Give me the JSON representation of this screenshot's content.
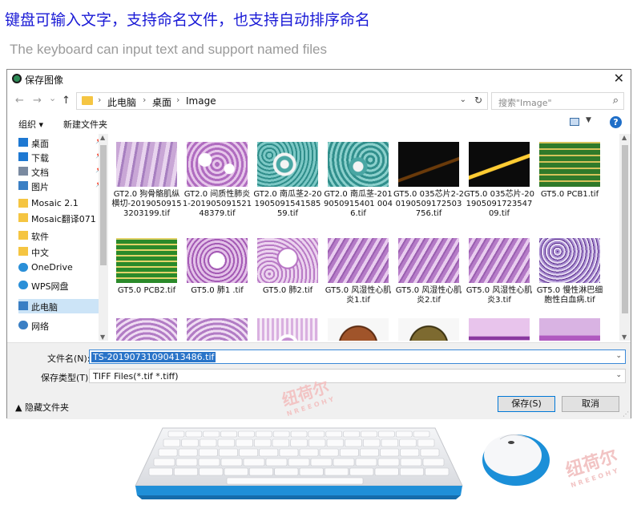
{
  "promo": {
    "cn": "键盘可输入文字，支持命名文件，也支持自动排序命名",
    "en": "The keyboard can input text and support named files"
  },
  "dialog": {
    "title": "保存图像",
    "close_glyph": "✕",
    "nav": {
      "back": "←",
      "forward": "→",
      "recent": "⌄",
      "up": "↑"
    },
    "breadcrumb": [
      "此电脑",
      "桌面",
      "Image"
    ],
    "search_placeholder": "搜索\"Image\"",
    "toolbar": {
      "organize": "组织 ▾",
      "new_folder": "新建文件夹",
      "help": "?"
    },
    "nav_pane": [
      {
        "label": "桌面",
        "icon": "desktop-icon",
        "pinned": true
      },
      {
        "label": "下载",
        "icon": "download-icon",
        "pinned": true
      },
      {
        "label": "文档",
        "icon": "document-icon",
        "pinned": true
      },
      {
        "label": "图片",
        "icon": "picture-icon",
        "pinned": true
      },
      {
        "label": "Mosaic 2.1",
        "icon": "folder-icon",
        "pinned": false
      },
      {
        "label": "Mosaic翻译071",
        "icon": "folder-icon",
        "pinned": false
      },
      {
        "label": "软件",
        "icon": "folder-icon",
        "pinned": false
      },
      {
        "label": "中文",
        "icon": "folder-icon",
        "pinned": false
      },
      {
        "label": "OneDrive",
        "icon": "cloud-icon",
        "pinned": false
      },
      {
        "label": "WPS网盘",
        "icon": "cloud-icon",
        "pinned": false
      },
      {
        "label": "此电脑",
        "icon": "computer-icon",
        "pinned": false,
        "selected": true
      },
      {
        "label": "网络",
        "icon": "network-icon",
        "pinned": false
      }
    ],
    "files": [
      {
        "caption": "GT2.0 狗骨骼肌纵横切-20190509153203199.tif",
        "thumb": "muscle"
      },
      {
        "caption": "GT2.0 间质性肺炎1-20190509152148379.tif",
        "thumb": "lung"
      },
      {
        "caption": "GT2.0 南瓜茎2-20190509154158559.tif",
        "thumb": "stem"
      },
      {
        "caption": "GT2.0 南瓜茎-2019050915401 0046.tif",
        "thumb": "stem2"
      },
      {
        "caption": "GT5.0 035芯片2-20190509172503756.tif",
        "thumb": "chip"
      },
      {
        "caption": "GT5.0 035芯片-20190509172354709.tif",
        "thumb": "chip2"
      },
      {
        "caption": "GT5.0 PCB1.tif",
        "thumb": "pcb"
      },
      {
        "caption": "GT5.0 PCB2.tif",
        "thumb": "pcb2"
      },
      {
        "caption": "GT5.0 肺1 .tif",
        "thumb": "lung2"
      },
      {
        "caption": "GT5.0 肺2.tif",
        "thumb": "lung3"
      },
      {
        "caption": "GT5.0 风湿性心肌炎1.tif",
        "thumb": "heart"
      },
      {
        "caption": "GT5.0 风湿性心肌炎2.tif",
        "thumb": "heart"
      },
      {
        "caption": "GT5.0 风湿性心肌炎3.tif",
        "thumb": "heart"
      },
      {
        "caption": "GT5.0 慢性淋巴细胞性白血病.tif",
        "thumb": "blood"
      },
      {
        "caption": "",
        "thumb": "intestine"
      },
      {
        "caption": "",
        "thumb": "intestine"
      },
      {
        "caption": "",
        "thumb": "intestine2"
      },
      {
        "caption": "",
        "thumb": "coin"
      },
      {
        "caption": "",
        "thumb": "coin2"
      },
      {
        "caption": "",
        "thumb": "tissue"
      },
      {
        "caption": "",
        "thumb": "tissue2"
      }
    ],
    "file_name_label": "文件名(N):",
    "file_name_value": "TS-20190731090413486.tif",
    "file_type_label": "保存类型(T):",
    "file_type_value": "TIFF Files(*.tif *.tiff)",
    "hide_folders": "▲ 隐藏文件夹",
    "save_button": "保存(S)",
    "cancel_button": "取消"
  },
  "watermark": {
    "cn": "纽荷尔",
    "en": "NREEOHY"
  },
  "colors": {
    "promo_cn": "#1a1ad6",
    "selection": "#2a74c8",
    "accent": "#0078d7"
  }
}
